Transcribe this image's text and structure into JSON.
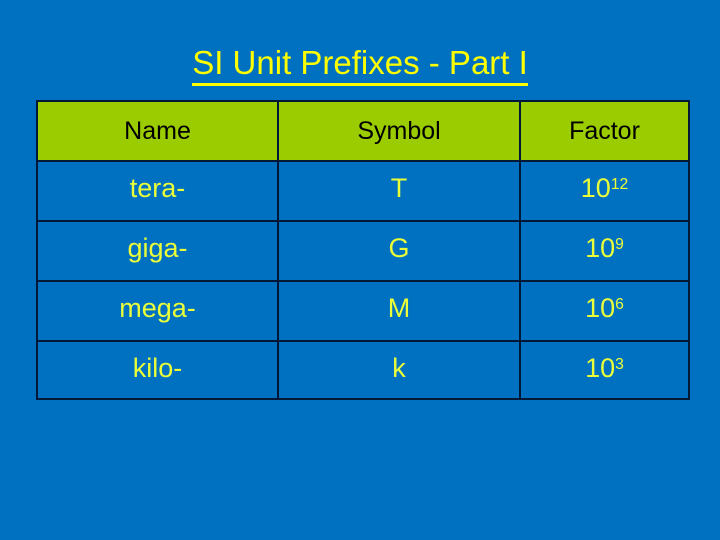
{
  "slide": {
    "title": "SI Unit Prefixes - Part I",
    "background_color": "#0070c0",
    "title_color": "#ffff00",
    "header_background_color": "#9bcc00",
    "header_text_color": "#000000",
    "body_text_color": "#eaff3a",
    "border_color": "#001838"
  },
  "table": {
    "headers": {
      "name": "Name",
      "symbol": "Symbol",
      "factor": "Factor"
    },
    "rows": [
      {
        "name": "tera-",
        "symbol": "T",
        "factor_base": "10",
        "factor_exponent": "12"
      },
      {
        "name": "giga-",
        "symbol": "G",
        "factor_base": "10",
        "factor_exponent": "9"
      },
      {
        "name": "mega-",
        "symbol": "M",
        "factor_base": "10",
        "factor_exponent": "6"
      },
      {
        "name": "kilo-",
        "symbol": "k",
        "factor_base": "10",
        "factor_exponent": "3"
      }
    ]
  }
}
